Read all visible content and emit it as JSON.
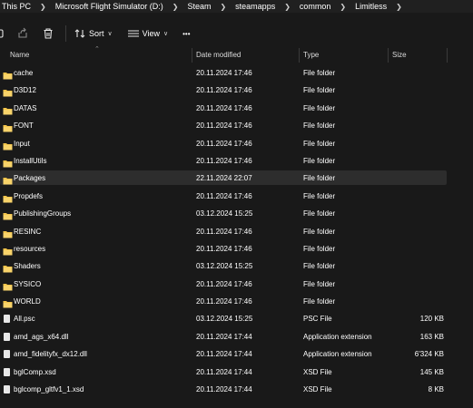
{
  "breadcrumb": [
    "This PC",
    "Microsoft Flight Simulator (D:)",
    "Steam",
    "steamapps",
    "common",
    "Limitless"
  ],
  "toolbar": {
    "sort_label": "Sort",
    "view_label": "View",
    "more_label": "•••",
    "sort_icon": "sort-icon",
    "view_icon": "view-lines-icon",
    "share_icon": "share-icon",
    "delete_icon": "trash-icon"
  },
  "columns": {
    "name": "Name",
    "date": "Date modified",
    "type": "Type",
    "size": "Size"
  },
  "colors": {
    "background": "#191919",
    "folder": "#f4c54b",
    "selected_row": "#2d2d2d"
  },
  "files": [
    {
      "name": "cache",
      "date": "20.11.2024 17:46",
      "type": "File folder",
      "size": "",
      "kind": "folder"
    },
    {
      "name": "D3D12",
      "date": "20.11.2024 17:46",
      "type": "File folder",
      "size": "",
      "kind": "folder"
    },
    {
      "name": "DATAS",
      "date": "20.11.2024 17:46",
      "type": "File folder",
      "size": "",
      "kind": "folder"
    },
    {
      "name": "FONT",
      "date": "20.11.2024 17:46",
      "type": "File folder",
      "size": "",
      "kind": "folder"
    },
    {
      "name": "Input",
      "date": "20.11.2024 17:46",
      "type": "File folder",
      "size": "",
      "kind": "folder"
    },
    {
      "name": "InstallUtils",
      "date": "20.11.2024 17:46",
      "type": "File folder",
      "size": "",
      "kind": "folder"
    },
    {
      "name": "Packages",
      "date": "22.11.2024 22:07",
      "type": "File folder",
      "size": "",
      "kind": "folder",
      "selected": true
    },
    {
      "name": "Propdefs",
      "date": "20.11.2024 17:46",
      "type": "File folder",
      "size": "",
      "kind": "folder"
    },
    {
      "name": "PublishingGroups",
      "date": "03.12.2024 15:25",
      "type": "File folder",
      "size": "",
      "kind": "folder"
    },
    {
      "name": "RESINC",
      "date": "20.11.2024 17:46",
      "type": "File folder",
      "size": "",
      "kind": "folder"
    },
    {
      "name": "resources",
      "date": "20.11.2024 17:46",
      "type": "File folder",
      "size": "",
      "kind": "folder"
    },
    {
      "name": "Shaders",
      "date": "03.12.2024 15:25",
      "type": "File folder",
      "size": "",
      "kind": "folder"
    },
    {
      "name": "SYSICO",
      "date": "20.11.2024 17:46",
      "type": "File folder",
      "size": "",
      "kind": "folder"
    },
    {
      "name": "WORLD",
      "date": "20.11.2024 17:46",
      "type": "File folder",
      "size": "",
      "kind": "folder"
    },
    {
      "name": "All.psc",
      "date": "03.12.2024 15:25",
      "type": "PSC File",
      "size": "120 KB",
      "kind": "file"
    },
    {
      "name": "amd_ags_x64.dll",
      "date": "20.11.2024 17:44",
      "type": "Application extension",
      "size": "163 KB",
      "kind": "file"
    },
    {
      "name": "amd_fidelityfx_dx12.dll",
      "date": "20.11.2024 17:44",
      "type": "Application extension",
      "size": "6'324 KB",
      "kind": "file"
    },
    {
      "name": "bglComp.xsd",
      "date": "20.11.2024 17:44",
      "type": "XSD File",
      "size": "145 KB",
      "kind": "file"
    },
    {
      "name": "bglcomp_gltfv1_1.xsd",
      "date": "20.11.2024 17:44",
      "type": "XSD File",
      "size": "8 KB",
      "kind": "file"
    }
  ]
}
